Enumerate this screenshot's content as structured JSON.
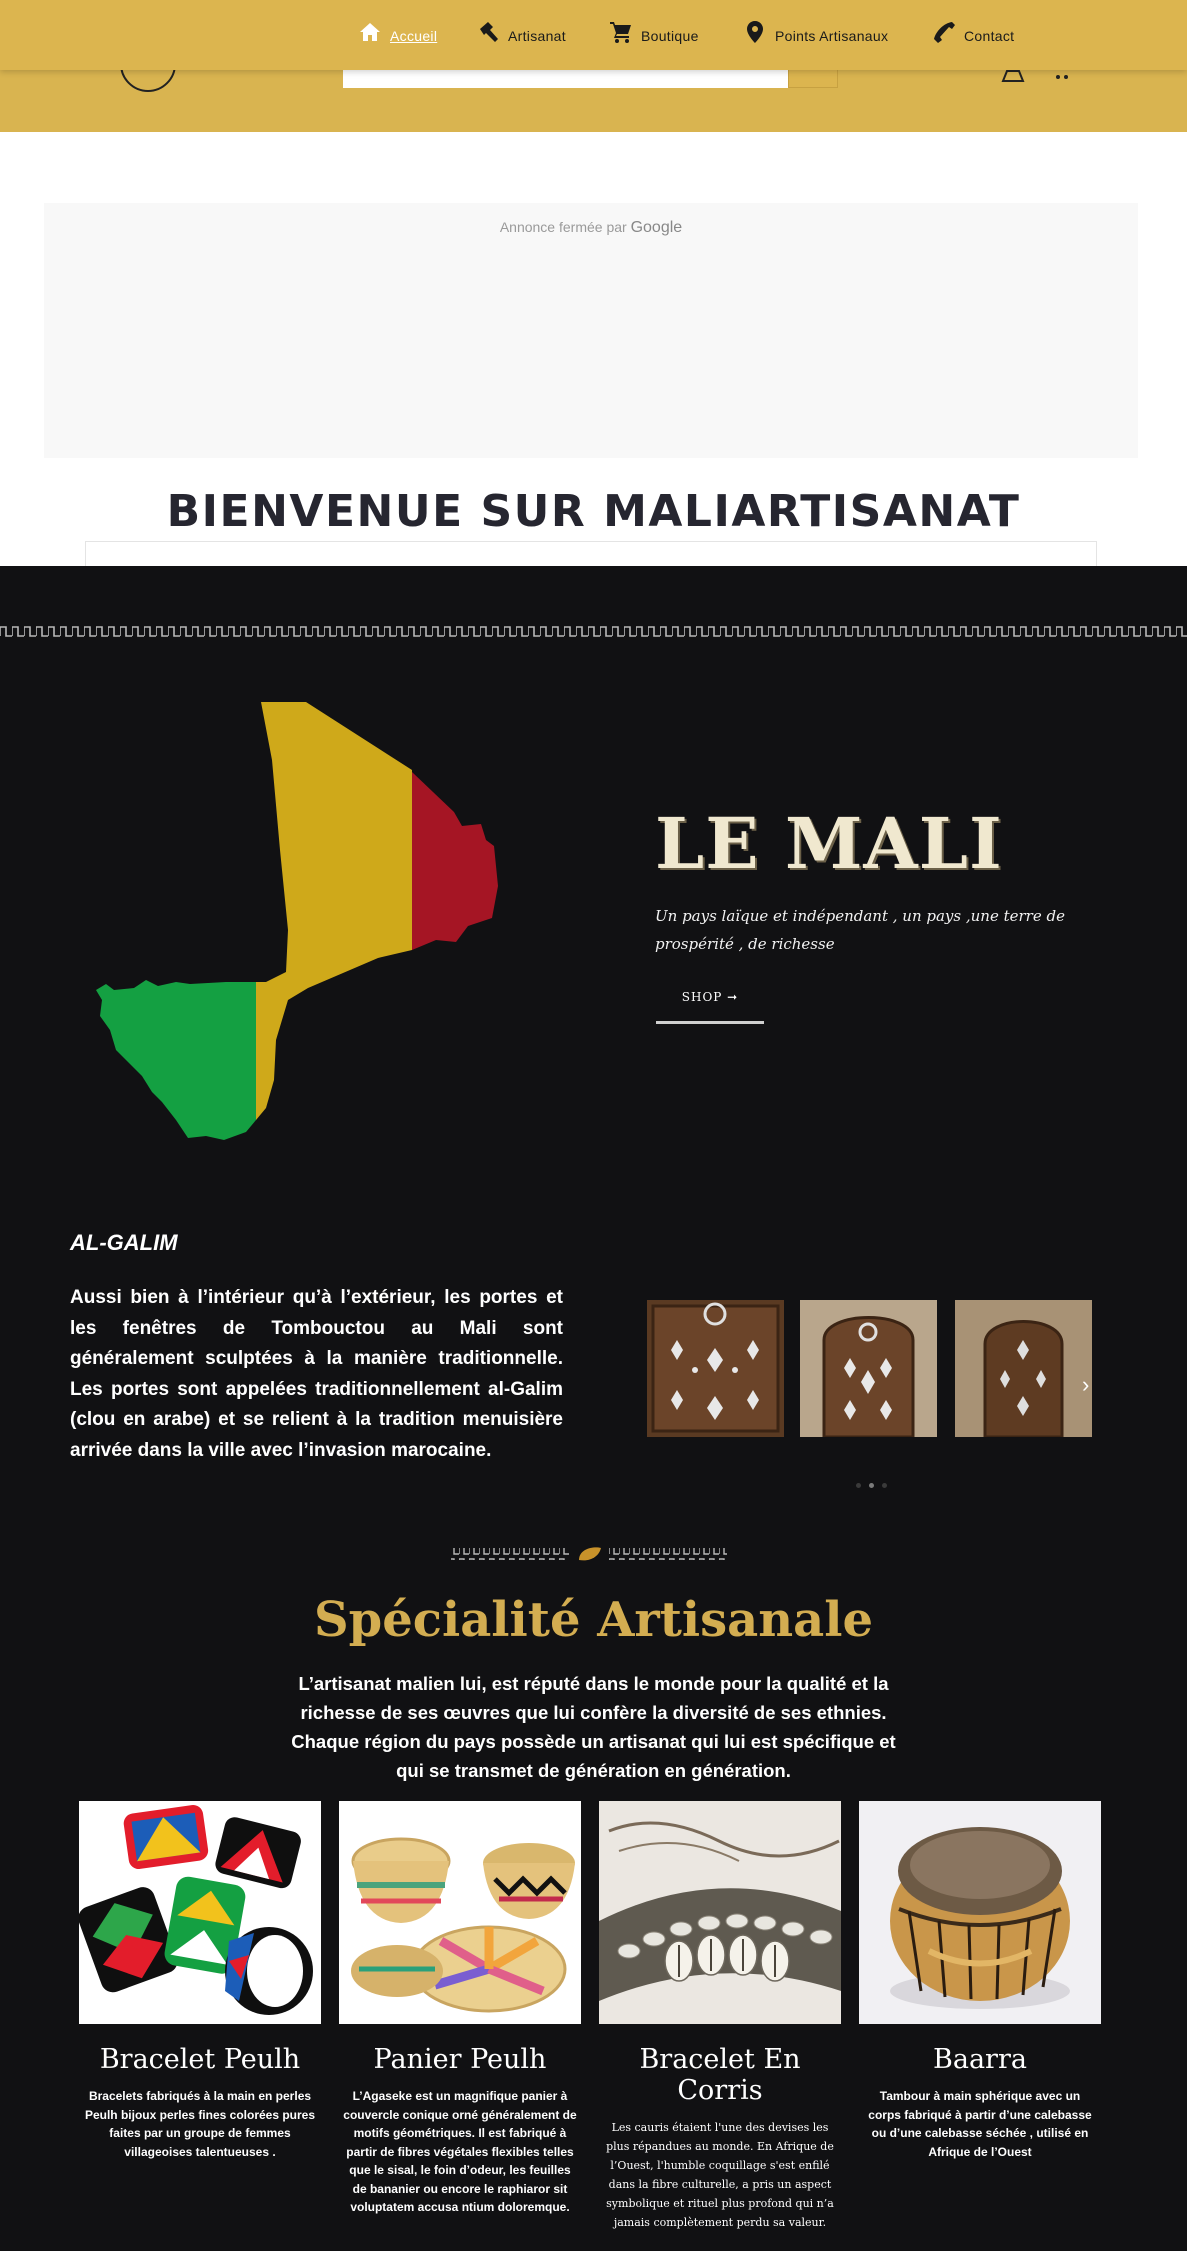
{
  "nav": {
    "items": [
      {
        "label": "Accueil",
        "icon": "home-icon",
        "active": true
      },
      {
        "label": "Artisanat",
        "icon": "hammer-icon",
        "active": false
      },
      {
        "label": "Boutique",
        "icon": "cart-icon",
        "active": false
      },
      {
        "label": "Points Artisanaux",
        "icon": "map-pin-icon",
        "active": false
      },
      {
        "label": "Contact",
        "icon": "phone-icon",
        "active": false
      }
    ]
  },
  "ad": {
    "text": "Annonce fermée par",
    "brand": "Google"
  },
  "welcome": {
    "title": "BIENVENUE SUR MALIARTISANAT"
  },
  "hero": {
    "title": "LE MALI",
    "subtitle": "Un pays laïque et indépendant , un pays ,une terre de prospérité , de richesse",
    "button": "SHOP ➞"
  },
  "algalim": {
    "title": "AL-GALIM",
    "text": "Aussi bien à l’intérieur qu’à l’extérieur, les portes et les fenêtres de Tombouctou au Mali sont généralement sculptées à la manière traditionnelle. Les portes sont appelées traditionnellement al-Galim (clou en arabe) et se relient à la tradition menuisière arrivée dans la ville avec l’invasion marocaine.",
    "carousel_arrow": "›"
  },
  "specialite": {
    "title": "Spécialité Artisanale",
    "text": "L’artisanat malien lui, est réputé dans le monde pour la qualité et la richesse de ses œuvres que lui confère la diversité de ses ethnies. Chaque région du pays possède un artisanat qui lui est spécifique et qui se transmet de génération en génération."
  },
  "products": [
    {
      "name": "Bracelet Peulh",
      "description": "Bracelets fabriqués à la main en perles Peulh bijoux perles fines colorées pures faites par un groupe de femmes villageoises talentueuses ."
    },
    {
      "name": "Panier Peulh",
      "description": "L’Agaseke est un magnifique panier à couvercle conique orné généralement de motifs géométriques. Il est fabriqué à partir de fibres végétales flexibles telles que le sisal, le foin d’odeur, les feuilles de bananier ou encore le raphiaror sit voluptatem accusa ntium doloremque."
    },
    {
      "name": "Bracelet En Corris",
      "description": "Les cauris  étaient l'une des devises les plus répandues au monde. En Afrique de l’Ouest, l'humble coquillage s'est enfilé dans la fibre culturelle, a pris un aspect symbolique et rituel plus profond qui n’a jamais complètement perdu sa valeur."
    },
    {
      "name": "Baarra",
      "description": "Tambour à main sphérique avec un corps fabriqué à partir d’une calebasse ou d’une calebasse séchée , utilisé en Afrique de l’Ouest"
    }
  ],
  "colors": {
    "gold": "#dcb54f",
    "dark": "#111113",
    "mali_green": "#14a042",
    "mali_yellow": "#cfa91a",
    "mali_red": "#a51524"
  }
}
